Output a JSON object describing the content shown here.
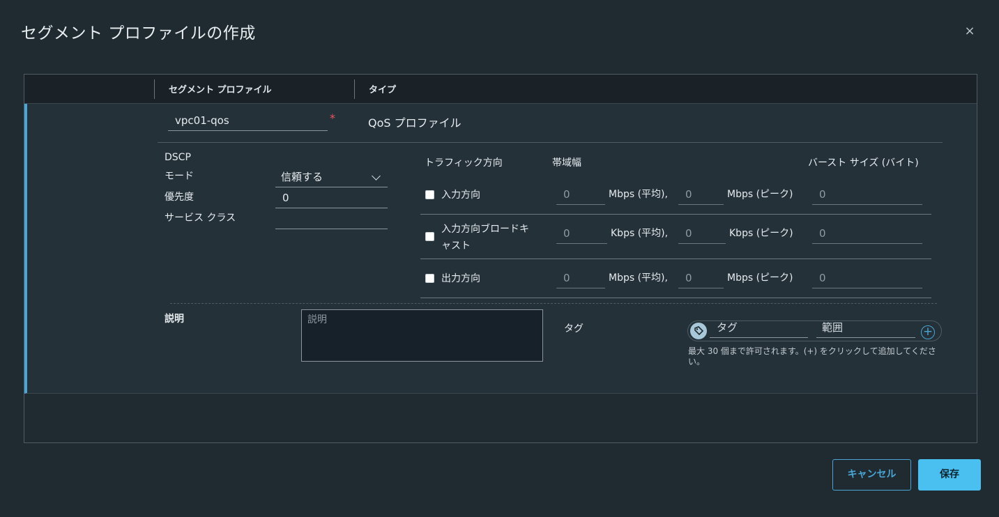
{
  "dialog": {
    "title": "セグメント プロファイルの作成",
    "close_icon": "×"
  },
  "table": {
    "columns": [
      "セグメント プロファイル",
      "タイプ"
    ]
  },
  "profile": {
    "name_value": "vpc01-qos",
    "required_mark": "*",
    "type_value": "QoS プロファイル"
  },
  "dscp": {
    "heading": "DSCP",
    "mode_label": "モード",
    "mode_value": "信頼する",
    "priority_label": "優先度",
    "priority_value": "0",
    "class_label": "サービス クラス",
    "class_value": ""
  },
  "traffic": {
    "direction_header": "トラフィック方向",
    "bandwidth_header": "帯域幅",
    "burst_header": "バースト サイズ (バイト)",
    "rows": [
      {
        "label": "入力方向",
        "avg": "0",
        "avg_unit": "Mbps (平均),",
        "peak": "0",
        "peak_unit": "Mbps (ピーク)",
        "burst": "0"
      },
      {
        "label": "入力方向ブロードキャスト",
        "label_line1": "入力方向ブロードキ",
        "label_line2": "ャスト",
        "avg": "0",
        "avg_unit": "Kbps (平均),",
        "peak": "0",
        "peak_unit": "Kbps (ピーク)",
        "burst": "0"
      },
      {
        "label": "出力方向",
        "avg": "0",
        "avg_unit": "Mbps (平均),",
        "peak": "0",
        "peak_unit": "Mbps (ピーク)",
        "burst": "0"
      }
    ]
  },
  "description": {
    "label": "説明",
    "placeholder": "説明"
  },
  "tags": {
    "label": "タグ",
    "tag_placeholder": "タグ",
    "scope_placeholder": "範囲",
    "hint": "最大 30 個まで許可されます。(+) をクリックして追加してください。"
  },
  "footer": {
    "cancel_label": "キャンセル",
    "save_label": "保存"
  },
  "colors": {
    "accent": "#49a6d5",
    "primary_button": "#49c0f0",
    "required": "#f0525a"
  }
}
